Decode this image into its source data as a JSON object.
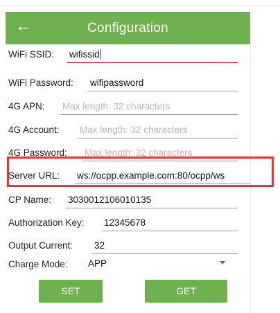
{
  "header": {
    "title": "Configuration",
    "back_icon": "arrow-left-icon"
  },
  "fields": [
    {
      "label": "WiFi SSID:",
      "value": "wifissid",
      "placeholder": ""
    },
    {
      "label": "WiFi Password:",
      "value": "wifipassword",
      "placeholder": ""
    },
    {
      "label": "4G APN:",
      "value": "",
      "placeholder": "Max length: 32 characters"
    },
    {
      "label": "4G Account:",
      "value": "",
      "placeholder": "Max length: 32 characters"
    },
    {
      "label": "4G Password:",
      "value": "",
      "placeholder": "Max length: 32 characters"
    },
    {
      "label": "Server URL:",
      "value": "ws://ocpp.example.com:80/ocpp/ws",
      "placeholder": ""
    },
    {
      "label": "CP Name:",
      "value": "3030012106010135",
      "placeholder": ""
    },
    {
      "label": "Authorization Key:",
      "value": "12345678",
      "placeholder": ""
    },
    {
      "label": "Output Current:",
      "value": "32",
      "placeholder": ""
    }
  ],
  "charge_mode": {
    "label": "Charge Mode:",
    "selected": "APP"
  },
  "buttons": {
    "set": "SET",
    "get": "GET"
  },
  "colors": {
    "accent": "#6fb14e",
    "highlight_box": "#e53838",
    "focus_underline": "#c2185b"
  }
}
